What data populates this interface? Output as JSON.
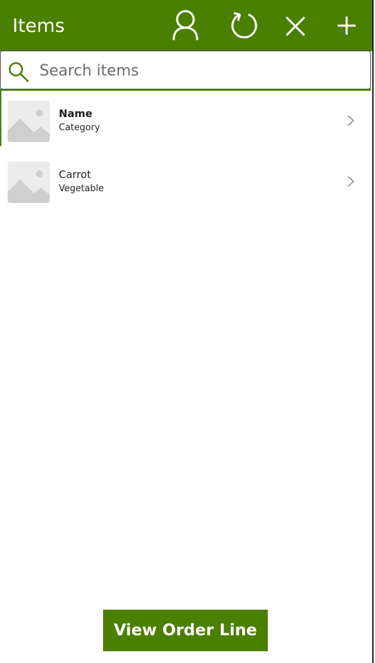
{
  "header": {
    "title": "Items",
    "icons": [
      "person-icon",
      "refresh-icon",
      "close-icon",
      "add-icon"
    ]
  },
  "search": {
    "placeholder": "Search items",
    "value": ""
  },
  "items": [
    {
      "title": "Name",
      "subtitle": "Category",
      "image": "image-placeholder-icon"
    },
    {
      "title": "Carrot",
      "subtitle": "Vegetable",
      "image": "image-placeholder-icon"
    }
  ],
  "footer": {
    "button_label": "View Order Line"
  },
  "colors": {
    "accent": "#4a7f00",
    "placeholder_bg": "#ececec",
    "placeholder_shape": "#cfcfcf"
  }
}
